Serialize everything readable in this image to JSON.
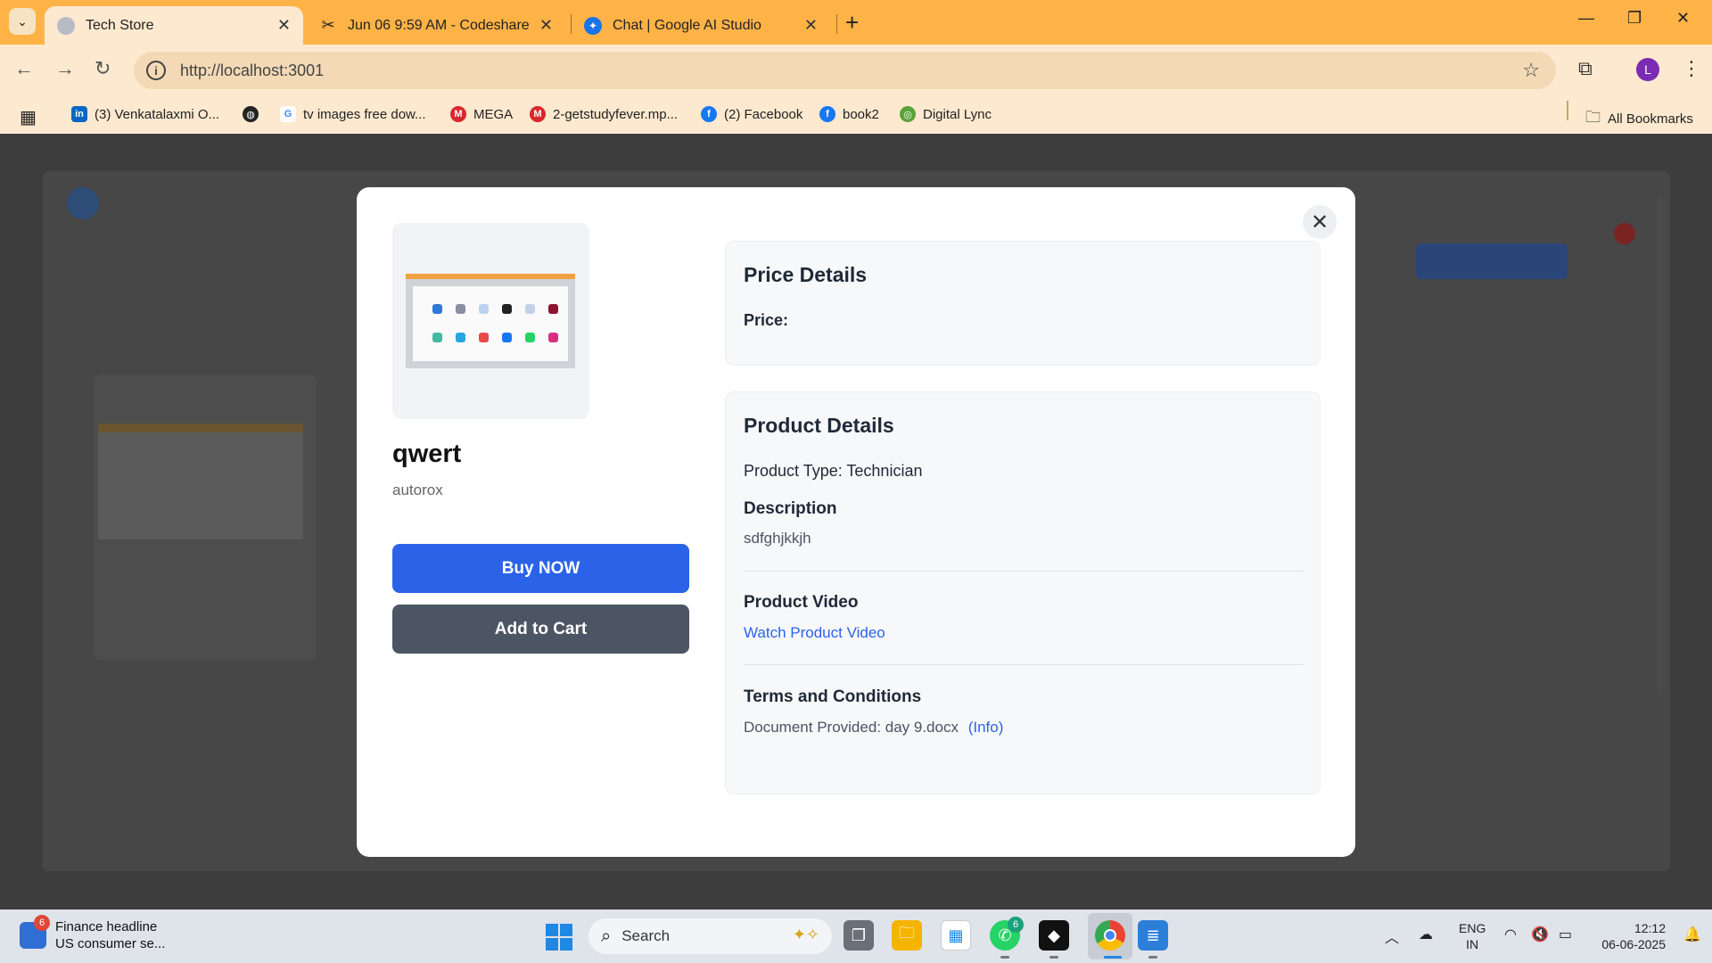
{
  "browser": {
    "tabs": [
      {
        "title": "Tech Store",
        "active": true
      },
      {
        "title": "Jun 06 9:59 AM - Codeshare",
        "active": false
      },
      {
        "title": "Chat | Google AI Studio",
        "active": false
      }
    ],
    "url": "http://localhost:3001",
    "profile_initial": "L",
    "bookmarks": [
      {
        "label": "(3) Venkatalaxmi O...",
        "icon": "linkedin-icon",
        "color": "#0a66c2"
      },
      {
        "label": "",
        "icon": "globe-icon",
        "color": "#222222"
      },
      {
        "label": "tv images free dow...",
        "icon": "google-icon",
        "color": "#4285f4"
      },
      {
        "label": "MEGA",
        "icon": "mega-icon",
        "color": "#d9272e"
      },
      {
        "label": "2-getstudyfever.mp...",
        "icon": "mega-icon",
        "color": "#d9272e"
      },
      {
        "label": "(2) Facebook",
        "icon": "facebook-icon",
        "color": "#1877f2"
      },
      {
        "label": "book2",
        "icon": "facebook-icon",
        "color": "#1877f2"
      },
      {
        "label": "Digital Lync",
        "icon": "digital-lync-icon",
        "color": "#5aa23a"
      }
    ],
    "all_bookmarks": "All Bookmarks"
  },
  "modal": {
    "product_name": "qwert",
    "brand": "autorox",
    "buy_label": "Buy NOW",
    "cart_label": "Add to Cart",
    "price_section": {
      "title": "Price Details",
      "price_label": "Price:"
    },
    "details_section": {
      "title": "Product Details",
      "product_type": "Product Type: Technician",
      "description_title": "Description",
      "description": "sdfghjkkjh",
      "video_title": "Product Video",
      "video_link": "Watch Product Video",
      "terms_title": "Terms and Conditions",
      "document": "Document Provided: day 9.docx",
      "info_link": "(Info)"
    }
  },
  "taskbar": {
    "news_badge": "6",
    "news_title": "Finance headline",
    "news_sub": "US consumer se...",
    "search_placeholder": "Search",
    "whatsapp_badge": "6",
    "lang_top": "ENG",
    "lang_bottom": "IN",
    "time": "12:12",
    "date": "06-06-2025"
  },
  "colors": {
    "accent_blue": "#2b63e8",
    "cart_gray": "#4b5563",
    "chrome_orange": "#ffb347"
  }
}
